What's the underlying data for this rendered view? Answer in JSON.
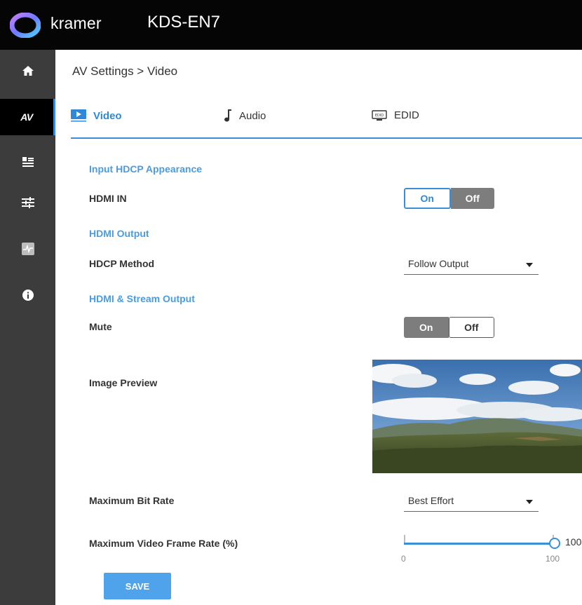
{
  "header": {
    "brand": "kramer",
    "model": "KDS-EN7"
  },
  "sidebar": {
    "items": [
      {
        "icon": "home-icon"
      },
      {
        "label": "AV",
        "active": true
      },
      {
        "icon": "device-settings-icon"
      },
      {
        "icon": "sliders-icon"
      },
      {
        "icon": "diagnostics-icon"
      },
      {
        "icon": "info-icon"
      }
    ]
  },
  "breadcrumb": "AV Settings > Video",
  "tabs": [
    {
      "label": "Video",
      "icon": "video-play-icon",
      "active": true
    },
    {
      "label": "Audio",
      "icon": "music-note-icon",
      "active": false
    },
    {
      "label": "EDID",
      "icon": "edid-monitor-icon",
      "active": false
    }
  ],
  "sections": {
    "input_hdcp": {
      "title": "Input HDCP Appearance",
      "hdmi_in_label": "HDMI IN",
      "on": "On",
      "off": "Off",
      "value": "On"
    },
    "hdmi_output": {
      "title": "HDMI Output",
      "hdcp_method_label": "HDCP Method",
      "hdcp_method_value": "Follow Output"
    },
    "stream_output": {
      "title": "HDMI & Stream Output",
      "mute_label": "Mute",
      "on": "On",
      "off": "Off",
      "mute_value": "Off",
      "image_preview_label": "Image Preview",
      "max_bitrate_label": "Maximum Bit Rate",
      "max_bitrate_value": "Best Effort",
      "max_framerate_label": "Maximum Video Frame Rate (%)",
      "framerate_value": "100",
      "framerate_min": "0",
      "framerate_max": "100"
    }
  },
  "save_label": "SAVE",
  "colors": {
    "accent": "#3a8fd8",
    "sidebar": "#3c3c3c",
    "header": "#050505"
  }
}
